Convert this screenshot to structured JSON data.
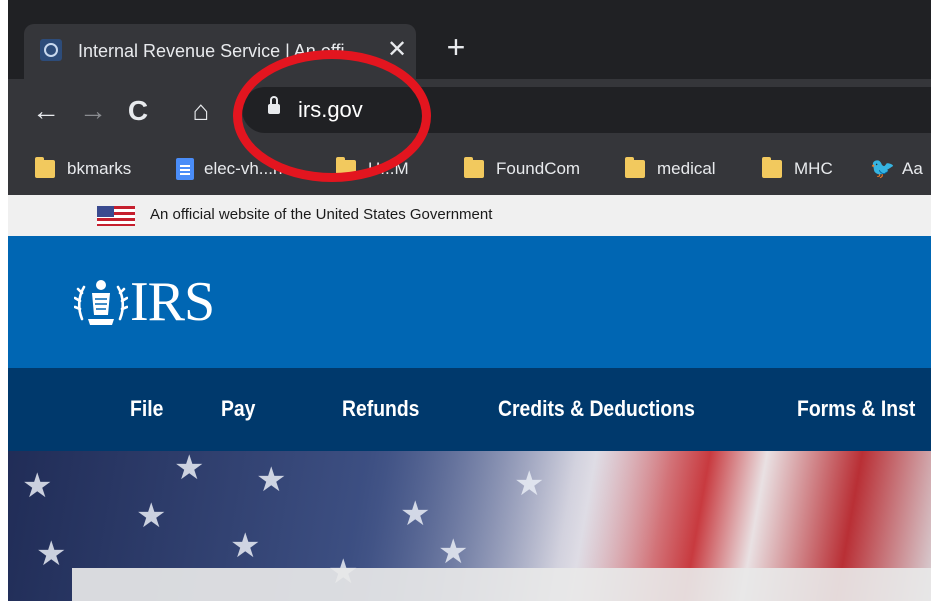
{
  "browser": {
    "tab": {
      "title": "Internal Revenue Service | An offi",
      "favicon": "irs-favicon-icon"
    },
    "url": "irs.gov",
    "bookmarks": [
      {
        "label": "bkmarks",
        "icon": "folder-icon"
      },
      {
        "label": "elec-vh...h",
        "icon": "doc-icon"
      },
      {
        "label": "H...M",
        "icon": "folder-icon"
      },
      {
        "label": "FoundCom",
        "icon": "folder-icon"
      },
      {
        "label": "medical",
        "icon": "folder-icon"
      },
      {
        "label": "MHC",
        "icon": "folder-icon"
      },
      {
        "label": "Aa",
        "icon": "twitter-bird-icon"
      }
    ]
  },
  "annotation": {
    "shape": "ellipse",
    "color": "#e3151f"
  },
  "gov_banner": {
    "text": "An official website of the United States Government"
  },
  "irs": {
    "logo_text": "IRS",
    "brand_color": "#0066b3",
    "nav_color": "#00396c",
    "nav": [
      "File",
      "Pay",
      "Refunds",
      "Credits & Deductions",
      "Forms & Inst"
    ]
  }
}
